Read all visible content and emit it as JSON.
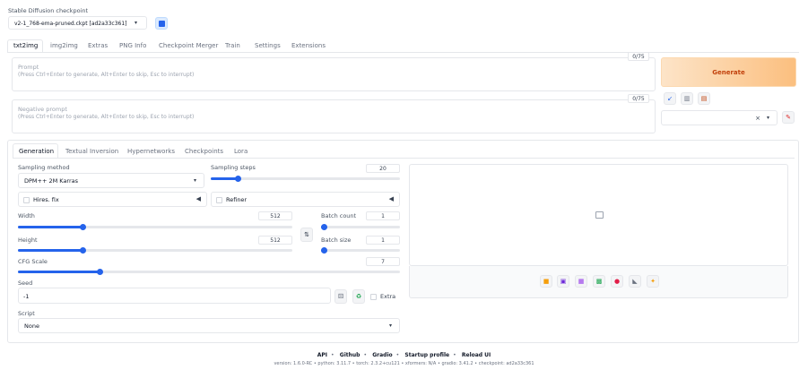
{
  "checkpoint": {
    "label": "Stable Diffusion checkpoint",
    "value": "v2-1_768-ema-pruned.ckpt [ad2a33c361]"
  },
  "top_tabs": [
    "txt2img",
    "img2img",
    "Extras",
    "PNG Info",
    "Checkpoint Merger",
    "Train",
    "Settings",
    "Extensions"
  ],
  "prompt": {
    "label": "Prompt",
    "placeholder": "(Press Ctrl+Enter to generate, Alt+Enter to skip, Esc to interrupt)",
    "counter": "0/75"
  },
  "negative_prompt": {
    "label": "Negative prompt",
    "placeholder": "(Press Ctrl+Enter to generate, Alt+Enter to skip, Esc to interrupt)",
    "counter": "0/75"
  },
  "generate_label": "Generate",
  "sub_tabs": [
    "Generation",
    "Textual Inversion",
    "Hypernetworks",
    "Checkpoints",
    "Lora"
  ],
  "sampling": {
    "method_label": "Sampling method",
    "method_value": "DPM++ 2M Karras",
    "steps_label": "Sampling steps",
    "steps_value": "20",
    "steps_fraction": 0.13
  },
  "hires_label": "Hires. fix",
  "refiner_label": "Refiner",
  "width": {
    "label": "Width",
    "value": "512",
    "fraction": 0.23
  },
  "height": {
    "label": "Height",
    "value": "512",
    "fraction": 0.23
  },
  "batch_count": {
    "label": "Batch count",
    "value": "1",
    "fraction": 0.0
  },
  "batch_size": {
    "label": "Batch size",
    "value": "1",
    "fraction": 0.0
  },
  "cfg": {
    "label": "CFG Scale",
    "value": "7",
    "fraction": 0.21
  },
  "seed": {
    "label": "Seed",
    "value": "-1",
    "extra_label": "Extra"
  },
  "script": {
    "label": "Script",
    "value": "None"
  },
  "footer": {
    "links": [
      "API",
      "Github",
      "Gradio",
      "Startup profile",
      "Reload UI"
    ],
    "version_line": "version: 1.6.0-RC  •  python: 3.11.7  •  torch: 2.3.2+cu121  •  xformers: N/A  •  gradio: 3.41.2  •  checkpoint: ad2a33c361"
  },
  "colors": {
    "accent": "#2563eb",
    "generate_from": "#fde4c8",
    "generate_to": "#fbbf7f",
    "generate_text": "#c2410c"
  }
}
